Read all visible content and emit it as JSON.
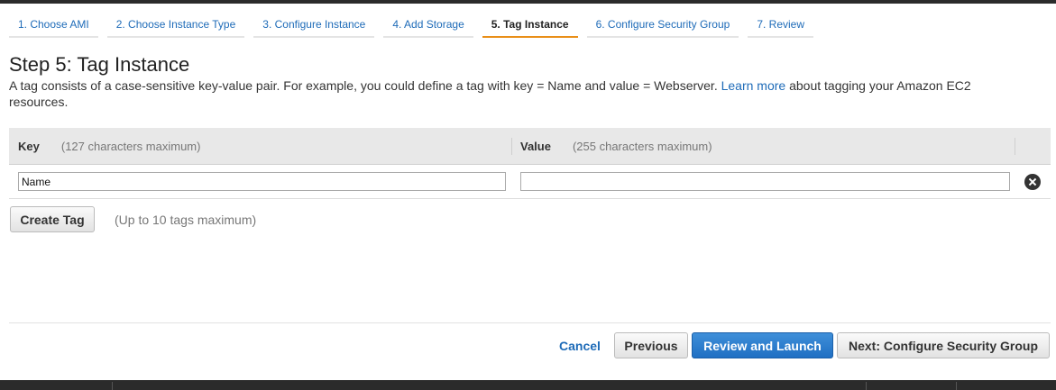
{
  "wizard": {
    "steps": [
      {
        "label": "1. Choose AMI"
      },
      {
        "label": "2. Choose Instance Type"
      },
      {
        "label": "3. Configure Instance"
      },
      {
        "label": "4. Add Storage"
      },
      {
        "label": "5. Tag Instance"
      },
      {
        "label": "6. Configure Security Group"
      },
      {
        "label": "7. Review"
      }
    ],
    "active_step": "5. Tag Instance"
  },
  "page": {
    "title": "Step 5: Tag Instance",
    "description_before": "A tag consists of a case-sensitive key-value pair. For example, you could define a tag with key = Name and value = Webserver.",
    "learn_more": "Learn more",
    "description_after": "about tagging your Amazon EC2 resources."
  },
  "tags_table": {
    "key_header": "Key",
    "key_hint": "(127 characters maximum)",
    "value_header": "Value",
    "value_hint": "(255 characters maximum)",
    "rows": [
      {
        "key": "Name",
        "value": ""
      }
    ]
  },
  "actions": {
    "create_tag": "Create Tag",
    "tag_limit": "(Up to 10 tags maximum)",
    "cancel": "Cancel",
    "previous": "Previous",
    "review_launch": "Review and Launch",
    "next": "Next: Configure Security Group"
  },
  "colors": {
    "link": "#1e6bb8",
    "active_step_underline": "#e98f18",
    "primary_button": "#1f6fc3"
  }
}
